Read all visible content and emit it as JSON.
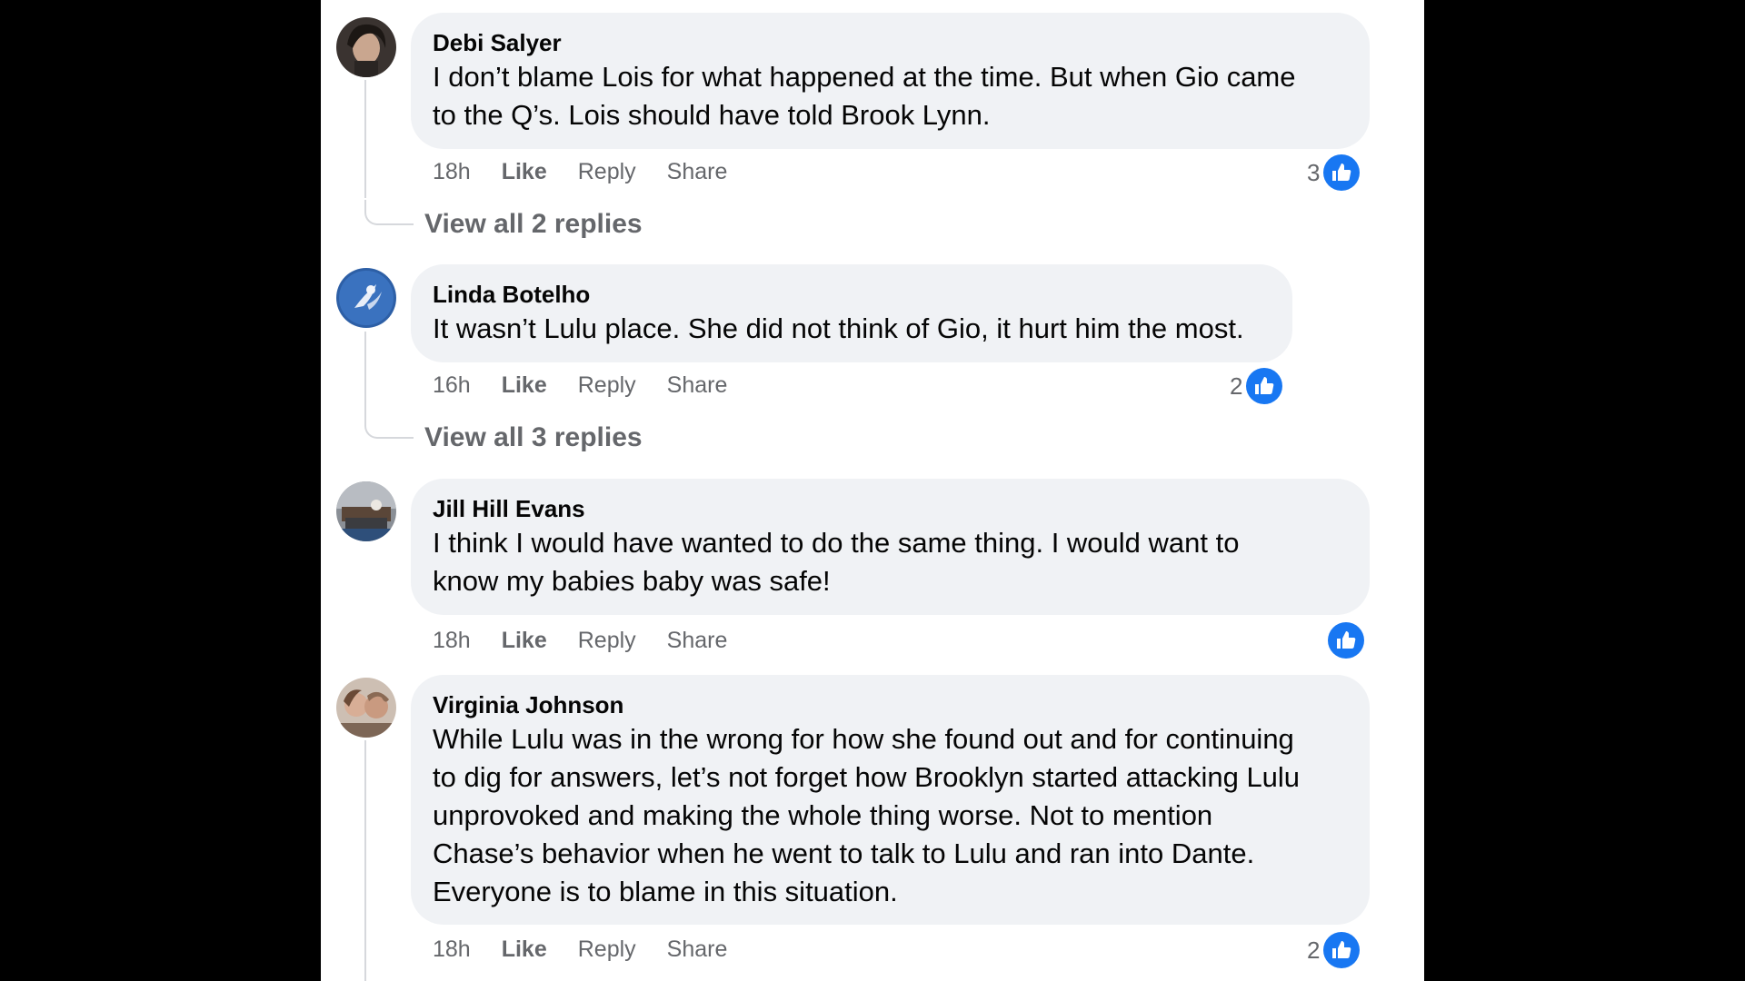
{
  "colors": {
    "background_side": "#000000",
    "panel": "#ffffff",
    "bubble": "#f0f2f5",
    "text_primary": "#050505",
    "text_secondary": "#65676b",
    "like_blue": "#1877f2"
  },
  "comments": [
    {
      "author": "Debi Salyer",
      "lines": [
        "I don’t blame Lois for what happened at the time. But when Gio came",
        "to the Q’s. Lois should have told Brook Lynn."
      ],
      "time": "18h",
      "like_label": "Like",
      "reply_label": "Reply",
      "share_label": "Share",
      "reaction_count": "3",
      "reaction_icon": "thumbs-up-icon",
      "view_replies": "View all 2 replies"
    },
    {
      "author": "Linda Botelho",
      "lines": [
        "It wasn’t Lulu place. She did not think of Gio, it hurt him the most."
      ],
      "time": "16h",
      "like_label": "Like",
      "reply_label": "Reply",
      "share_label": "Share",
      "reaction_count": "2",
      "reaction_icon": "thumbs-up-icon",
      "view_replies": "View all 3 replies"
    },
    {
      "author": "Jill Hill Evans",
      "lines": [
        "I think I would have wanted to do the same thing. I would want to",
        "know my babies baby was safe!"
      ],
      "time": "18h",
      "like_label": "Like",
      "reply_label": "Reply",
      "share_label": "Share",
      "reaction_count": "",
      "reaction_icon": "thumbs-up-icon"
    },
    {
      "author": "Virginia Johnson",
      "lines": [
        "While Lulu was in the wrong for how she found out and for continuing",
        "to dig for answers, let’s not forget how Brooklyn started attacking Lulu",
        "unprovoked and making the whole thing worse. Not to mention",
        "Chase’s behavior when he went to talk to Lulu and ran into Dante.",
        "Everyone is to blame in this situation."
      ],
      "time": "18h",
      "like_label": "Like",
      "reply_label": "Reply",
      "share_label": "Share",
      "reaction_count": "2",
      "reaction_icon": "thumbs-up-icon"
    }
  ]
}
